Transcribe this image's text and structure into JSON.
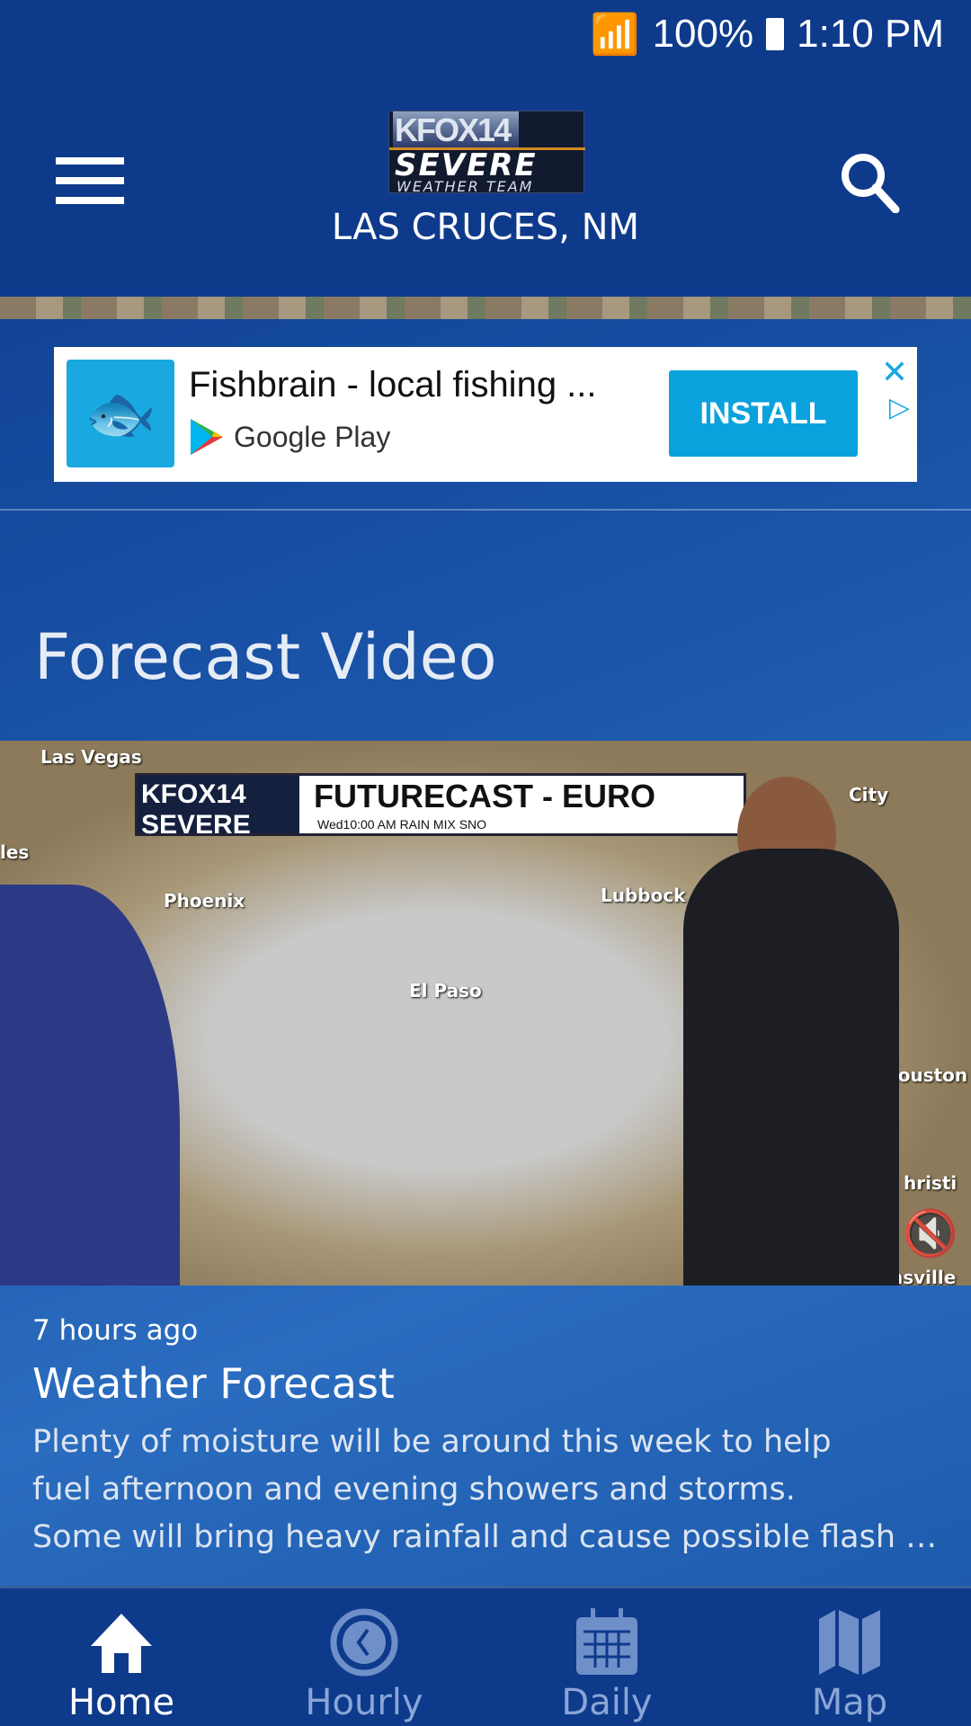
{
  "status": {
    "battery": "100%",
    "time": "1:10 PM"
  },
  "header": {
    "logo_text": "KFOX14 SEVERE WEATHER TEAM",
    "location": "LAS CRUCES, NM"
  },
  "ad": {
    "title": "Fishbrain - local fishing ...",
    "store": "Google Play",
    "install": "INSTALL"
  },
  "section": {
    "title": "Forecast Video"
  },
  "video": {
    "banner_logo": "KFOX14 SEVERE",
    "banner_title": "FUTURECAST - EURO",
    "banner_sub": "Wed10:00 AM  RAIN  MIX  SNO",
    "cities": [
      "Las Vegas",
      "Phoenix",
      "El Paso",
      "Lubbock",
      "City",
      "Houston",
      "hristi",
      "nsville",
      "les"
    ],
    "age": "7 hours ago",
    "title": "Weather Forecast",
    "description": [
      "Plenty of moisture will be around this week to help",
      "fuel afternoon and evening showers and storms.",
      "Some will bring heavy rainfall and cause possible flash flooding."
    ]
  },
  "nav": [
    {
      "label": "Home",
      "icon": "home-icon",
      "active": true
    },
    {
      "label": "Hourly",
      "icon": "clock-icon"
    },
    {
      "label": "Daily",
      "icon": "calendar-icon"
    },
    {
      "label": "Map",
      "icon": "map-icon"
    }
  ],
  "colors": {
    "header": "#0e3a8c",
    "install": "#0aa2dc",
    "nav_inactive": "#8aa6d6"
  }
}
